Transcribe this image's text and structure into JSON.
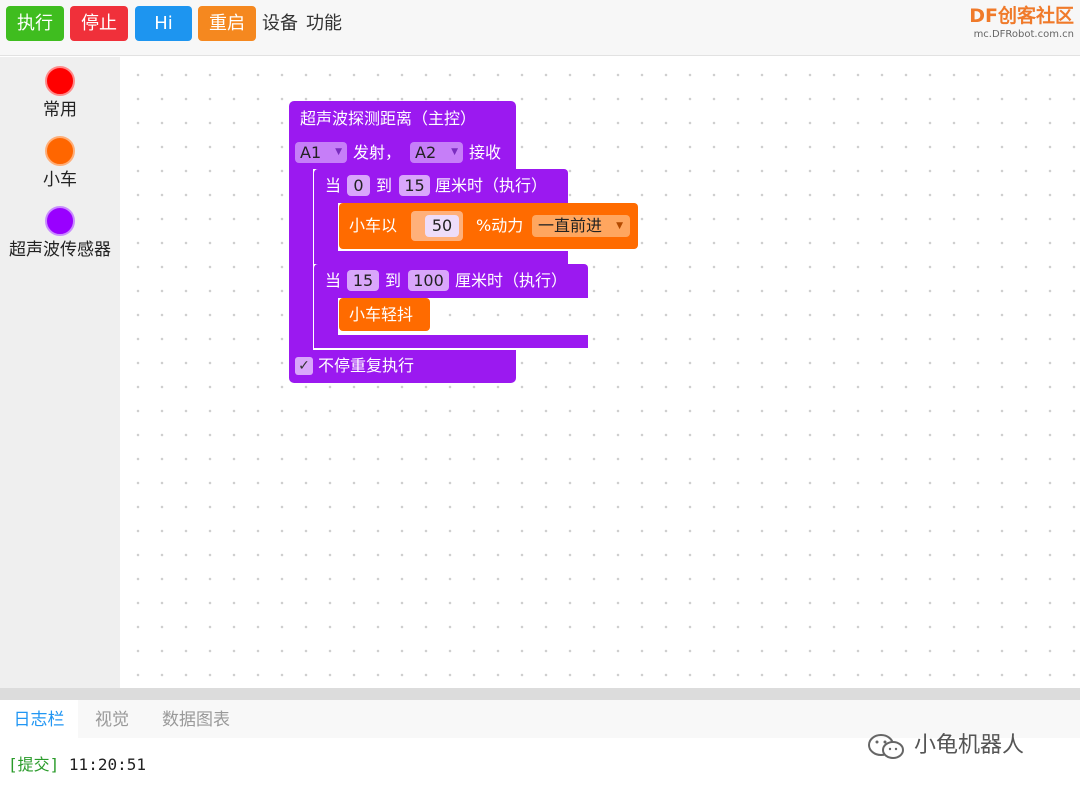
{
  "toolbar": {
    "run_label": "执行",
    "stop_label": "停止",
    "hi_label": "Hi",
    "restart_label": "重启",
    "menu_device": "设备",
    "menu_function": "功能"
  },
  "logo": {
    "main": "DF创客社区",
    "sub": "mc.DFRobot.com.cn"
  },
  "colors": {
    "run": "#3fbd1f",
    "stop": "#f0303a",
    "hi": "#1d95f0",
    "restart": "#f5881f",
    "block_purple": "#9b19f0",
    "block_orange": "#ff6b00"
  },
  "sidebar": {
    "categories": [
      {
        "label": "常用",
        "color": "#ff0000"
      },
      {
        "label": "小车",
        "color": "#ff6600"
      },
      {
        "label": "超声波传感器",
        "color": "#9900ff"
      }
    ]
  },
  "blocks": {
    "main_title": "超声波探测距离（主控）",
    "trig_pin": "A1",
    "trig_text": "发射，",
    "echo_pin": "A2",
    "echo_text": "接收",
    "range1": {
      "when": "当",
      "from": "0",
      "to_text": "到",
      "to": "15",
      "unit_text": "厘米时（执行）"
    },
    "car_move": {
      "prefix": "小车以",
      "power": "50",
      "suffix": "%动力",
      "direction": "一直前进"
    },
    "range2": {
      "when": "当",
      "from": "15",
      "to_text": "到",
      "to": "100",
      "unit_text": "厘米时（执行）"
    },
    "car_shake": "小车轻抖",
    "repeat_check": "✓",
    "repeat_label": "不停重复执行"
  },
  "bottom_tabs": [
    "日志栏",
    "视觉",
    "数据图表"
  ],
  "log": {
    "tag": "[提交]",
    "time": "11:20:51"
  },
  "watermark": "小龟机器人"
}
